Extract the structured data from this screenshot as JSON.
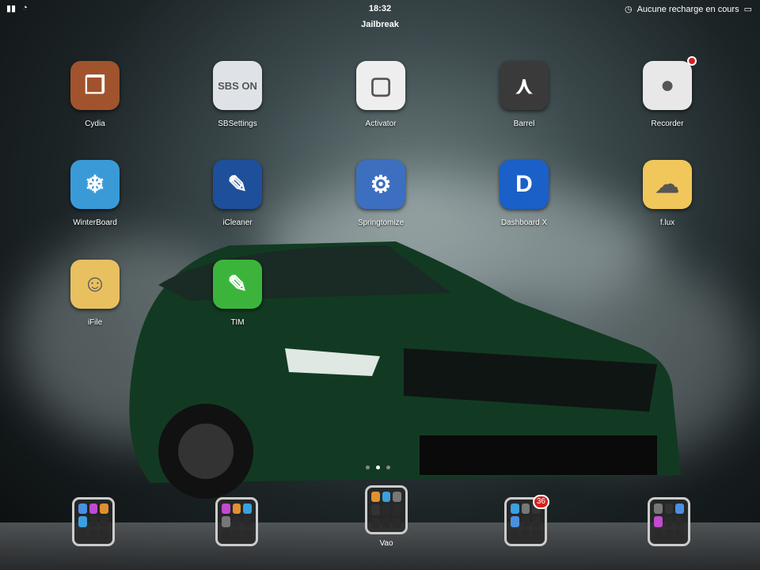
{
  "status": {
    "time": "18:32",
    "charging": "Aucune recharge en cours"
  },
  "page_title": "Jailbreak",
  "apps": [
    {
      "label": "Cydia",
      "glyph": "❒",
      "bg": "#a0532c"
    },
    {
      "label": "SBSettings",
      "glyph": "SBS ON",
      "bg": "#dfe3e8"
    },
    {
      "label": "Activator",
      "glyph": "▢",
      "bg": "#eeeeee"
    },
    {
      "label": "Barrel",
      "glyph": "⋏",
      "bg": "#3a3a3a"
    },
    {
      "label": "Recorder",
      "glyph": "●",
      "bg": "#e8e8e8"
    },
    {
      "label": "WinterBoard",
      "glyph": "❄",
      "bg": "#3a9ad8"
    },
    {
      "label": "iCleaner",
      "glyph": "✎",
      "bg": "#1e4f9a"
    },
    {
      "label": "Springtomize",
      "glyph": "⚙",
      "bg": "#3d6fc0"
    },
    {
      "label": "Dashboard X",
      "glyph": "D",
      "bg": "#1a60c8"
    },
    {
      "label": "f.lux",
      "glyph": "☁",
      "bg": "#f1c65a"
    },
    {
      "label": "iFile",
      "glyph": "☺",
      "bg": "#e8c060"
    },
    {
      "label": "TIM",
      "glyph": "✎",
      "bg": "#3cb43c"
    }
  ],
  "dock": {
    "folders": [
      {
        "label": ""
      },
      {
        "label": ""
      },
      {
        "label": "Vao"
      },
      {
        "label": "",
        "badge": "36"
      },
      {
        "label": ""
      }
    ]
  },
  "page_indicator": {
    "count": 3,
    "current": 2
  }
}
